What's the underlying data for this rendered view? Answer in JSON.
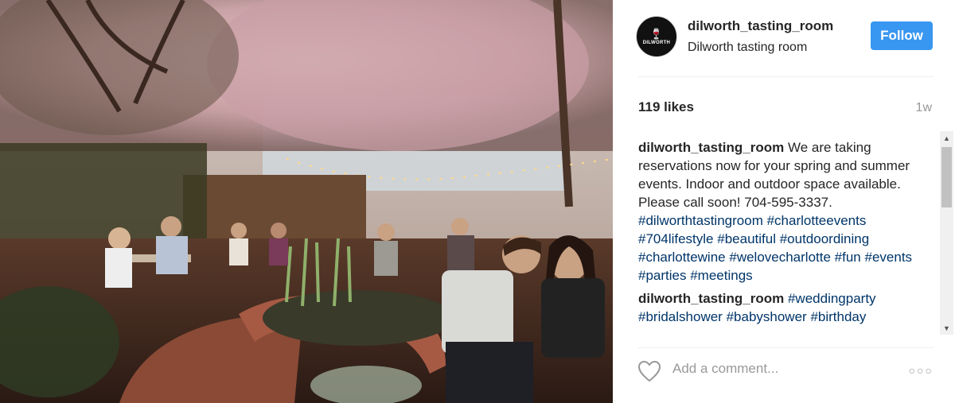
{
  "post": {
    "username": "dilworth_tasting_room",
    "location": "Dilworth tasting room",
    "follow_label": "Follow",
    "avatar_text": "DILWORTH",
    "likes": "119 likes",
    "age": "1w"
  },
  "comments": [
    {
      "user": "dilworth_tasting_room",
      "text": "We are taking reservations now for your spring and summer events. Indoor and outdoor space available. Please call soon! 704-595-3337.",
      "tags": [
        "#dilworthtastingroom",
        "#charlotteevents",
        "#704lifestyle",
        "#beautiful",
        "#outdoordining",
        "#charlottewine",
        "#welovecharlotte",
        "#fun",
        "#events",
        "#parties",
        "#meetings"
      ]
    },
    {
      "user": "dilworth_tasting_room",
      "text": "",
      "tags": [
        "#weddingparty",
        "#bridalshower",
        "#babyshower",
        "#birthday"
      ]
    }
  ],
  "comment_input": {
    "placeholder": "Add a comment..."
  },
  "icons": {
    "heart": "heart-outline-icon",
    "more": "more-options-icon",
    "scroll_up": "scroll-up-arrow",
    "scroll_down": "scroll-down-arrow"
  },
  "colors": {
    "follow_bg": "#3897f0",
    "hashtag": "#003569",
    "muted": "#999999"
  }
}
